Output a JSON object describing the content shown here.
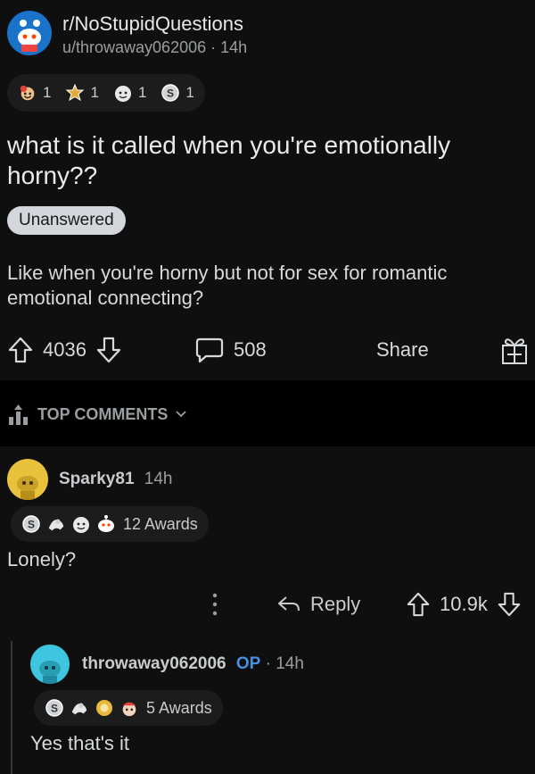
{
  "post": {
    "subreddit": "r/NoStupidQuestions",
    "author": "u/throwaway062006",
    "age": "14h",
    "awards": [
      {
        "icon": "laughing-face-award-icon",
        "count": "1"
      },
      {
        "icon": "star-badge-award-icon",
        "count": "1"
      },
      {
        "icon": "wholesome-face-award-icon",
        "count": "1"
      },
      {
        "icon": "silver-coin-award-icon",
        "count": "1"
      }
    ],
    "title": "what is it called when you're emotionally horny??",
    "flair": "Unanswered",
    "body": "Like when you're horny but not for sex for romantic emotional connecting?",
    "score": "4036",
    "comments": "508",
    "share": "Share"
  },
  "sort": {
    "label": "TOP COMMENTS"
  },
  "comment1": {
    "author": "Sparky81",
    "age": "14h",
    "awards_label": "12 Awards",
    "body": "Lonely?",
    "reply": "Reply",
    "score": "10.9k"
  },
  "comment2": {
    "author": "throwaway062006",
    "op": "OP",
    "age": "14h",
    "awards_label": "5 Awards",
    "body": "Yes that's it"
  },
  "colors": {
    "background": "#0f0f0f",
    "divider_band": "#000000",
    "op_blue": "#4a90e2",
    "sparky_avatar": "#e8c23a",
    "op_avatar": "#3ec6e0"
  }
}
